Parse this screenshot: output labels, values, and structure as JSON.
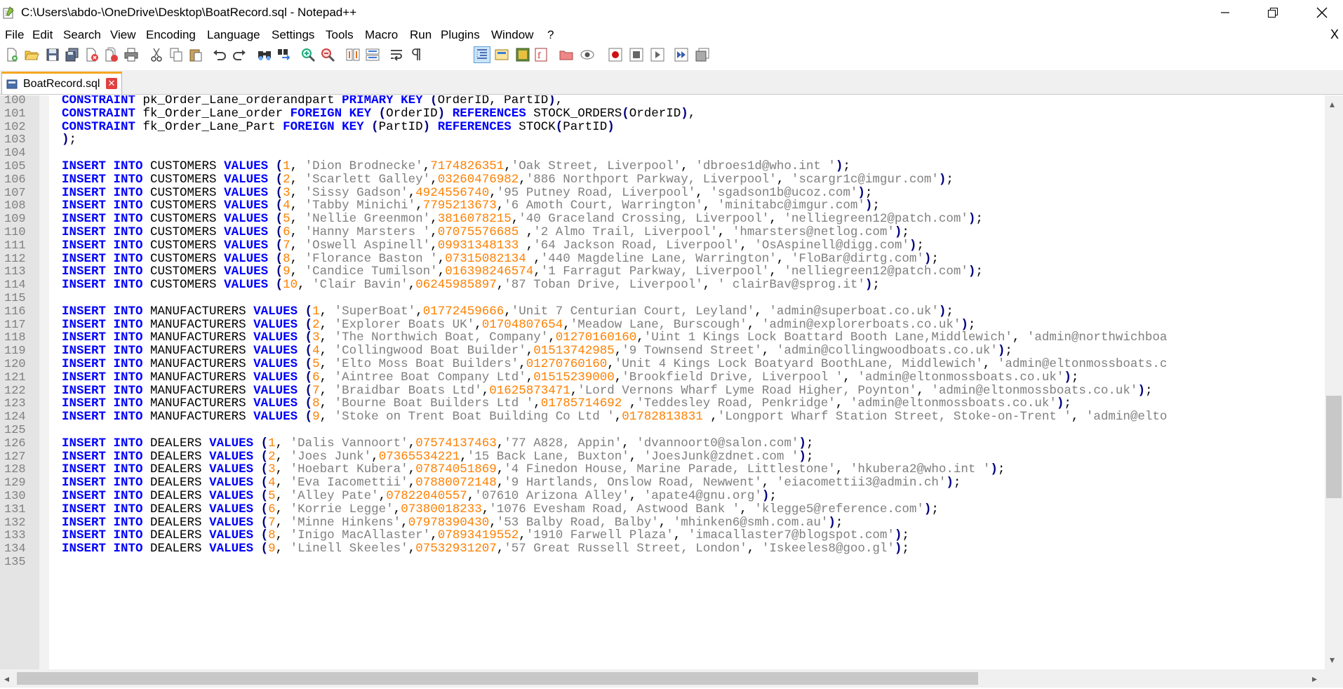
{
  "window": {
    "title": "C:\\Users\\abdo-\\OneDrive\\Desktop\\BoatRecord.sql - Notepad++"
  },
  "menu": [
    "File",
    "Edit",
    "Search",
    "View",
    "Encoding",
    "Language",
    "Settings",
    "Tools",
    "Macro",
    "Run",
    "Plugins",
    "Window",
    "?"
  ],
  "menu_close": "X",
  "tab": {
    "label": "BoatRecord.sql"
  },
  "colors": {
    "keyword": "#0000ff",
    "number": "#ff8000",
    "string": "#808080",
    "line_number": "#808080",
    "tab_accent": "#f5a623"
  },
  "lines": [
    {
      "n": "100",
      "t": "CONSTRAINT pk_Order_Lane_orderandpart PRIMARY KEY (OrderID, PartID),"
    },
    {
      "n": "101",
      "t": "CONSTRAINT fk_Order_Lane_order FOREIGN KEY (OrderID) REFERENCES STOCK_ORDERS(OrderID),"
    },
    {
      "n": "102",
      "t": "CONSTRAINT fk_Order_Lane_Part FOREIGN KEY (PartID) REFERENCES STOCK(PartID)"
    },
    {
      "n": "103",
      "t": ");"
    },
    {
      "n": "104",
      "t": ""
    },
    {
      "n": "105",
      "t": "INSERT INTO CUSTOMERS VALUES (1, 'Dion Brodnecke',7174826351,'Oak Street, Liverpool', 'dbroes1d@who.int ');"
    },
    {
      "n": "106",
      "t": "INSERT INTO CUSTOMERS VALUES (2, 'Scarlett Galley',03260476982,'886 Northport Parkway, Liverpool', 'scargr1c@imgur.com');"
    },
    {
      "n": "107",
      "t": "INSERT INTO CUSTOMERS VALUES (3, 'Sissy Gadson',4924556740,'95 Putney Road, Liverpool', 'sgadson1b@ucoz.com');"
    },
    {
      "n": "108",
      "t": "INSERT INTO CUSTOMERS VALUES (4, 'Tabby Minichi',7795213673,'6 Amoth Court, Warrington', 'minitabc@imgur.com');"
    },
    {
      "n": "109",
      "t": "INSERT INTO CUSTOMERS VALUES (5, 'Nellie Greenmon',3816078215,'40 Graceland Crossing, Liverpool', 'nelliegreen12@patch.com');"
    },
    {
      "n": "110",
      "t": "INSERT INTO CUSTOMERS VALUES (6, 'Hanny Marsters ',07075576685 ,'2 Almo Trail, Liverpool', 'hmarsters@netlog.com');"
    },
    {
      "n": "111",
      "t": "INSERT INTO CUSTOMERS VALUES (7, 'Oswell Aspinell',09931348133 ,'64 Jackson Road, Liverpool', 'OsAspinell@digg.com');"
    },
    {
      "n": "112",
      "t": "INSERT INTO CUSTOMERS VALUES (8, 'Florance Baston ',07315082134 ,'440 Magdeline Lane, Warrington', 'FloBar@dirtg.com');"
    },
    {
      "n": "113",
      "t": "INSERT INTO CUSTOMERS VALUES (9, 'Candice Tumilson',016398246574,'1 Farragut Parkway, Liverpool', 'nelliegreen12@patch.com');"
    },
    {
      "n": "114",
      "t": "INSERT INTO CUSTOMERS VALUES (10, 'Clair Bavin',06245985897,'87 Toban Drive, Liverpool', ' clairBav@sprog.it');"
    },
    {
      "n": "115",
      "t": ""
    },
    {
      "n": "116",
      "t": "INSERT INTO MANUFACTURERS VALUES (1, 'SuperBoat',01772459666,'Unit 7 Centurian Court, Leyland', 'admin@superboat.co.uk');"
    },
    {
      "n": "117",
      "t": "INSERT INTO MANUFACTURERS VALUES (2, 'Explorer Boats UK',01704807654,'Meadow Lane, Burscough', 'admin@explorerboats.co.uk');"
    },
    {
      "n": "118",
      "t": "INSERT INTO MANUFACTURERS VALUES (3, 'The Northwich Boat, Company',01270160160,'Uint 1 Kings Lock Boattard Booth Lane,Middlewich', 'admin@northwichboa"
    },
    {
      "n": "119",
      "t": "INSERT INTO MANUFACTURERS VALUES (4, 'Collingwood Boat Builder',01513742985,'9 Townsend Street', 'admin@collingwoodboats.co.uk');"
    },
    {
      "n": "120",
      "t": "INSERT INTO MANUFACTURERS VALUES (5, 'Elto Moss Boat Builders',01270760160,'Unit 4 Kings Lock Boatyard BoothLane, Middlewich', 'admin@eltonmossboats.c"
    },
    {
      "n": "121",
      "t": "INSERT INTO MANUFACTURERS VALUES (6, 'Aintree Boat Company Ltd',01515239000,'Brookfield Drive, Liverpool ', 'admin@eltonmossboats.co.uk');"
    },
    {
      "n": "122",
      "t": "INSERT INTO MANUFACTURERS VALUES (7, 'Braidbar Boats Ltd',01625873471,'Lord Vernons Wharf Lyme Road Higher, Poynton', 'admin@eltonmossboats.co.uk');"
    },
    {
      "n": "123",
      "t": "INSERT INTO MANUFACTURERS VALUES (8, 'Bourne Boat Builders Ltd ',01785714692 ,'Teddesley Road, Penkridge', 'admin@eltonmossboats.co.uk');"
    },
    {
      "n": "124",
      "t": "INSERT INTO MANUFACTURERS VALUES (9, 'Stoke on Trent Boat Building Co Ltd ',01782813831 ,'Longport Wharf Station Street, Stoke-on-Trent ', 'admin@elto"
    },
    {
      "n": "125",
      "t": ""
    },
    {
      "n": "126",
      "t": "INSERT INTO DEALERS VALUES (1, 'Dalis Vannoort',07574137463,'77 A828, Appin', 'dvannoort0@salon.com');"
    },
    {
      "n": "127",
      "t": "INSERT INTO DEALERS VALUES (2, 'Joes Junk',07365534221,'15 Back Lane, Buxton', 'JoesJunk@zdnet.com ');"
    },
    {
      "n": "128",
      "t": "INSERT INTO DEALERS VALUES (3, 'Hoebart Kubera',07874051869,'4 Finedon House, Marine Parade, Littlestone', 'hkubera2@who.int ');"
    },
    {
      "n": "129",
      "t": "INSERT INTO DEALERS VALUES (4, 'Eva Iacomettii',07880072148,'9 Hartlands, Onslow Road, Newwent', 'eiacomettii3@admin.ch');"
    },
    {
      "n": "130",
      "t": "INSERT INTO DEALERS VALUES (5, 'Alley Pate',07822040557,'07610 Arizona Alley', 'apate4@gnu.org');"
    },
    {
      "n": "131",
      "t": "INSERT INTO DEALERS VALUES (6, 'Korrie Legge',07380018233,'1076 Evesham Road, Astwood Bank ', 'klegge5@reference.com');"
    },
    {
      "n": "132",
      "t": "INSERT INTO DEALERS VALUES (7, 'Minne Hinkens',07978390430,'53 Balby Road, Balby', 'mhinken6@smh.com.au');"
    },
    {
      "n": "133",
      "t": "INSERT INTO DEALERS VALUES (8, 'Inigo MacAllaster',07893419552,'1910 Farwell Plaza', 'imacallaster7@blogspot.com');"
    },
    {
      "n": "134",
      "t": "INSERT INTO DEALERS VALUES (9, 'Linell Skeeles',07532931207,'57 Great Russell Street, London', 'Iskeeles8@goo.gl');"
    },
    {
      "n": "135",
      "t": ""
    }
  ]
}
